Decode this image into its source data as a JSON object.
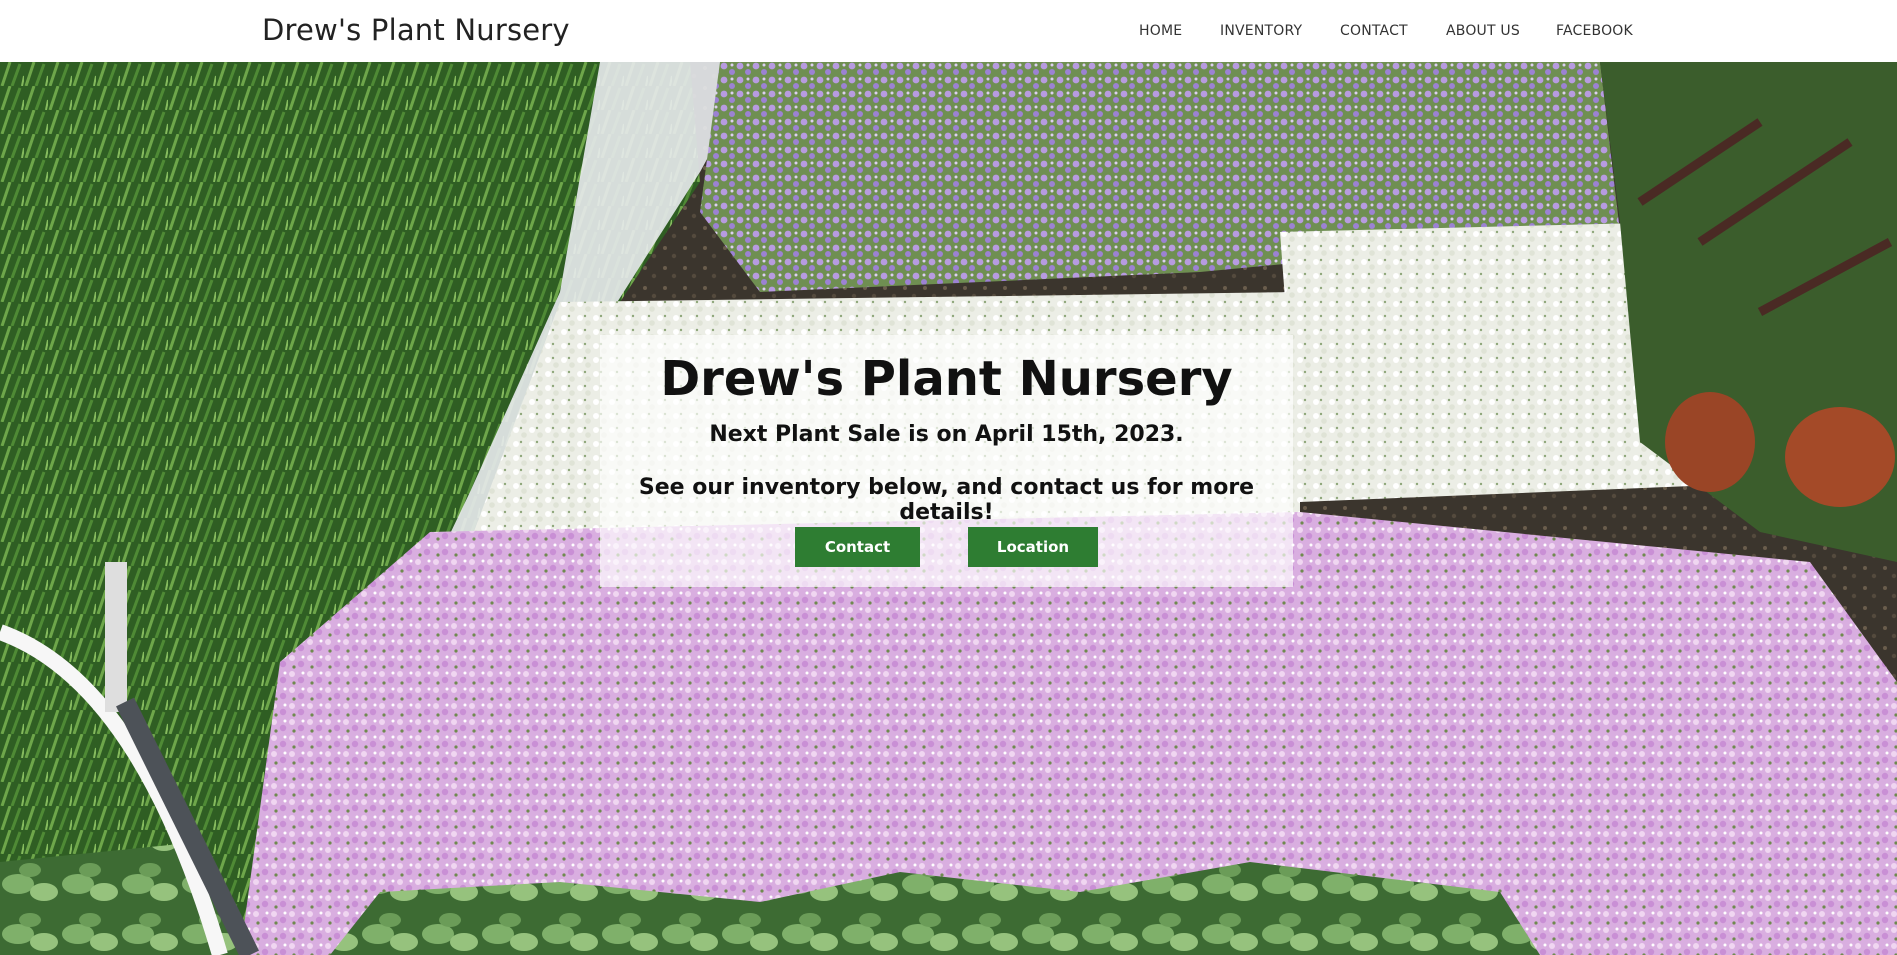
{
  "navbar": {
    "brand": "Drew's Plant Nursery",
    "links": [
      "HOME",
      "INVENTORY",
      "CONTACT",
      "ABOUT US",
      "FACEBOOK"
    ]
  },
  "hero": {
    "title": "Drew's Plant Nursery",
    "line1": "Next Plant Sale is on April 15th, 2023.",
    "line2": "See our inventory below, and contact us for more details!",
    "buttons": {
      "contact": "Contact",
      "location": "Location"
    },
    "colors": {
      "button": "#2e7d32",
      "foliage": "#3f7a2e",
      "lavender": "#b79be0",
      "pink_phlox": "#dcb3e4",
      "white_phlox": "#f3f3ee"
    }
  }
}
